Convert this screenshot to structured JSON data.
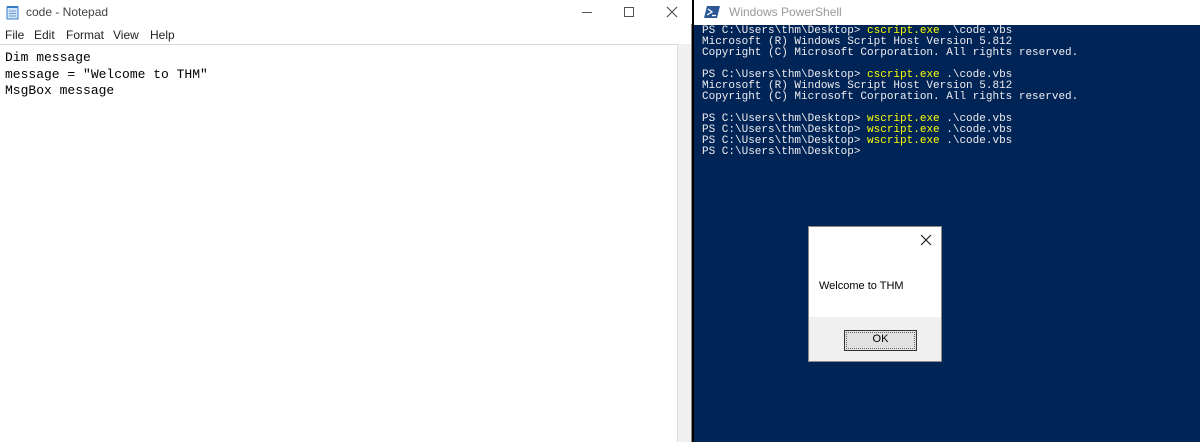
{
  "notepad": {
    "title": "code - Notepad",
    "menu": [
      "File",
      "Edit",
      "Format",
      "View",
      "Help"
    ],
    "lines": [
      "Dim message",
      "message = \"Welcome to THM\"",
      "MsgBox message"
    ]
  },
  "powershell": {
    "title": "Windows PowerShell",
    "prompt": "PS C:\\Users\\thm\\Desktop> ",
    "line1_cmd": "cscript.exe",
    "line1_arg": " .\\code.vbs",
    "line2": "Microsoft (R) Windows Script Host Version 5.812",
    "line3": "Copyright (C) Microsoft Corporation. All rights reserved.",
    "line5_cmd": "cscript.exe",
    "line5_arg": " .\\code.vbs",
    "line6": "Microsoft (R) Windows Script Host Version 5.812",
    "line7": "Copyright (C) Microsoft Corporation. All rights reserved.",
    "line9_cmd": "wscript.exe",
    "line9_arg": " .\\code.vbs",
    "line10_cmd": "wscript.exe",
    "line10_arg": " .\\code.vbs",
    "line11_cmd": "wscript.exe",
    "line11_arg": " .\\code.vbs",
    "line12": "PS C:\\Users\\thm\\Desktop>"
  },
  "msgbox": {
    "message": "Welcome to THM",
    "ok_label": "OK"
  },
  "colors": {
    "powershell_bg": "#012456",
    "command_yellow": "#ffff00"
  }
}
